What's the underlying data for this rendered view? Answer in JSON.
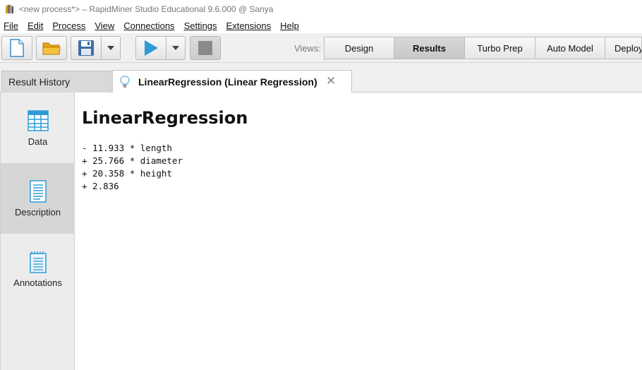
{
  "window": {
    "title": "<new process*> – RapidMiner Studio Educational 9.6.000 @ Sanya",
    "icon": "rapidminer-logo-icon"
  },
  "menu": [
    {
      "label": "File"
    },
    {
      "label": "Edit"
    },
    {
      "label": "Process"
    },
    {
      "label": "View"
    },
    {
      "label": "Connections"
    },
    {
      "label": "Settings"
    },
    {
      "label": "Extensions"
    },
    {
      "label": "Help"
    }
  ],
  "toolbar": {
    "icons": [
      "new-process-icon",
      "open-folder-icon",
      "save-icon",
      "dropdown-arrow-icon",
      "run-icon",
      "dropdown-arrow-icon",
      "stop-icon"
    ],
    "views_label": "Views:",
    "views": [
      {
        "label": "Design",
        "active": false
      },
      {
        "label": "Results",
        "active": true
      },
      {
        "label": "Turbo Prep",
        "active": false
      },
      {
        "label": "Auto Model",
        "active": false
      },
      {
        "label": "Deploy",
        "active": false
      }
    ]
  },
  "tabs": {
    "history_label": "Result History",
    "result_label": "LinearRegression (Linear Regression)",
    "result_icon": "lightbulb-icon",
    "close_icon": "close-icon"
  },
  "sidenav": [
    {
      "label": "Data",
      "icon": "data-table-icon",
      "selected": false
    },
    {
      "label": "Description",
      "icon": "description-document-icon",
      "selected": true
    },
    {
      "label": "Annotations",
      "icon": "annotations-notepad-icon",
      "selected": false
    }
  ],
  "model": {
    "title": "LinearRegression",
    "lines": [
      "- 11.933 * length",
      "+ 25.766 * diameter",
      "+ 20.358 * height",
      "+ 2.836"
    ]
  },
  "colors": {
    "accent_blue": "#2f9bd6",
    "selected_nav": "#d6d6d6",
    "active_view": "#cfcfcf"
  }
}
